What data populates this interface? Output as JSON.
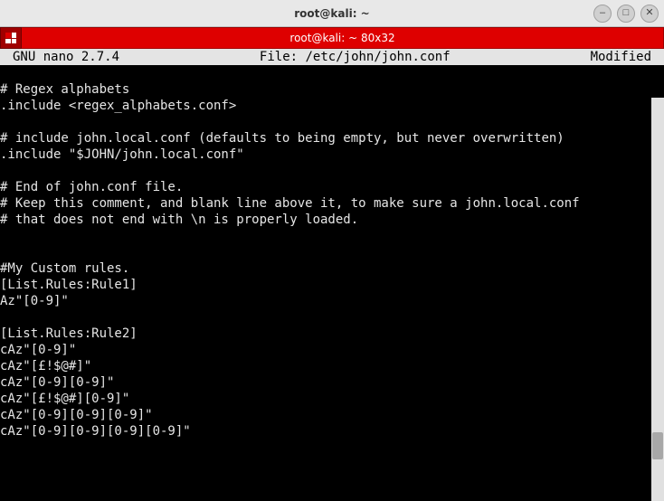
{
  "window": {
    "title": "root@kali: ~"
  },
  "tab": {
    "label": "root@kali: ~ 80x32"
  },
  "nano": {
    "app": "GNU nano 2.7.4",
    "file_label": "File: /etc/john/john.conf",
    "status": "Modified"
  },
  "lines": [
    "",
    "# Regex alphabets",
    ".include <regex_alphabets.conf>",
    "",
    "# include john.local.conf (defaults to being empty, but never overwritten)",
    ".include \"$JOHN/john.local.conf\"",
    "",
    "# End of john.conf file.",
    "# Keep this comment, and blank line above it, to make sure a john.local.conf",
    "# that does not end with \\n is properly loaded.",
    "",
    "",
    "#My Custom rules.",
    "[List.Rules:Rule1]",
    "Az\"[0-9]\"",
    "",
    "[List.Rules:Rule2]",
    "cAz\"[0-9]\"",
    "cAz\"[£!$@#]\"",
    "cAz\"[0-9][0-9]\"",
    "cAz\"[£!$@#][0-9]\"",
    "cAz\"[0-9][0-9][0-9]\"",
    "cAz\"[0-9][0-9][0-9][0-9]\""
  ]
}
